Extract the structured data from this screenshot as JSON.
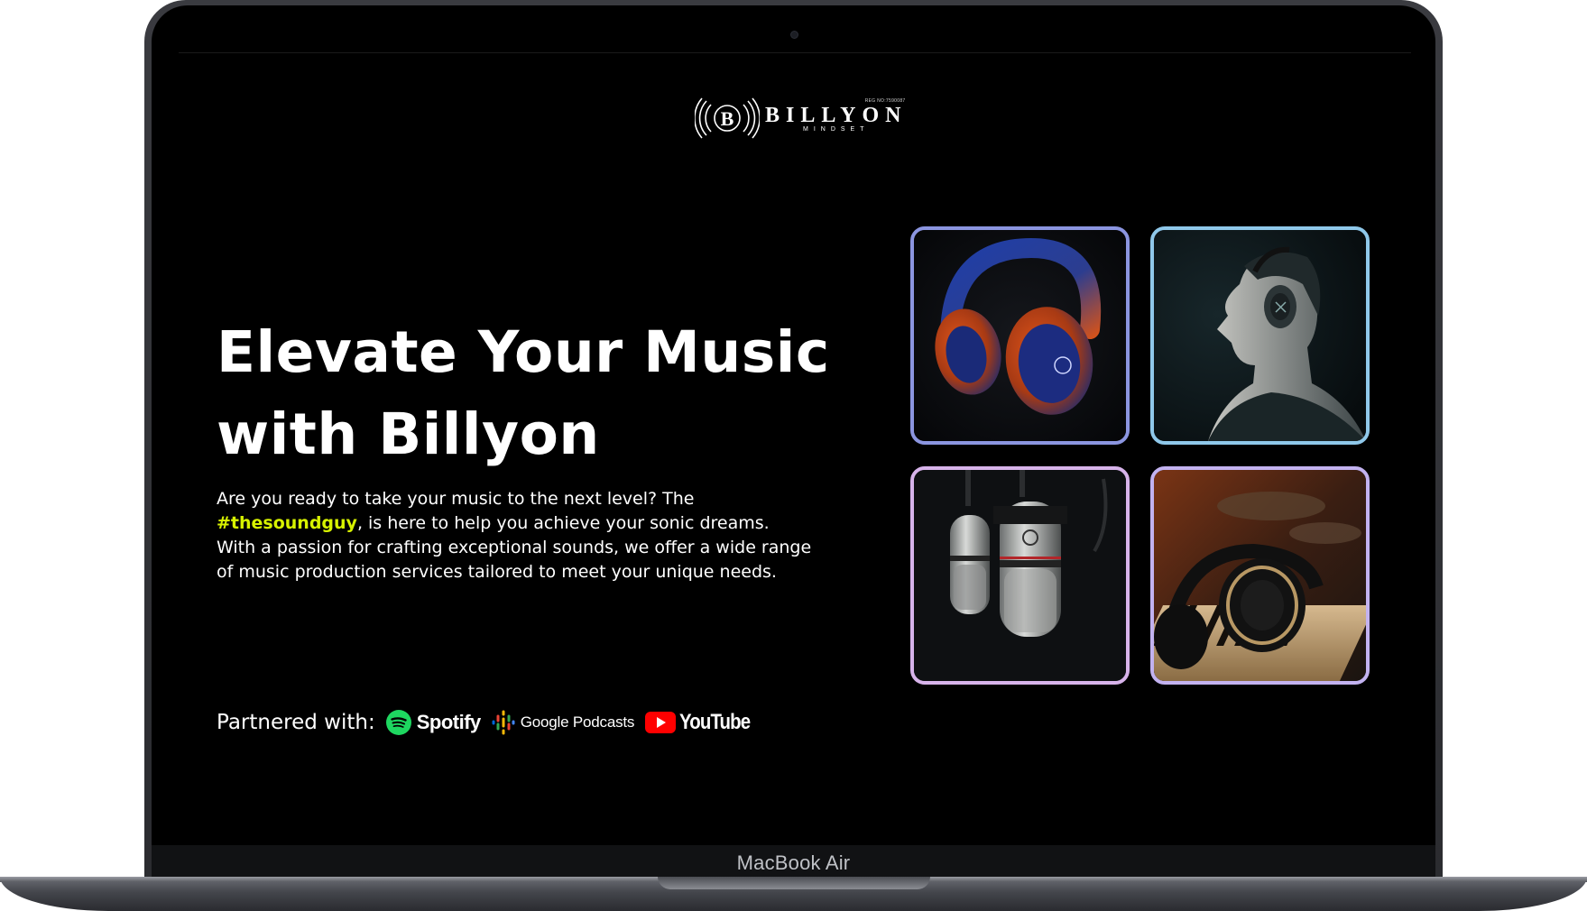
{
  "device": {
    "model_label": "MacBook Air"
  },
  "brand": {
    "logo_letter": "B",
    "name": "BILLYON",
    "tagline": "MINDSET",
    "reg_mark": "REG NO:7590087"
  },
  "hero": {
    "title_line1": "Elevate Your Music",
    "title_line2": "with Billyon",
    "body_part1": "Are you ready to take your music to the next level? The ",
    "hashtag": "#thesoundguy",
    "body_part2": ", is here to help you achieve your sonic dreams. With a passion for crafting exceptional sounds, we offer a wide range of music production services tailored to meet your unique needs."
  },
  "partners": {
    "label": "Partnered with:",
    "items": [
      {
        "name": "Spotify",
        "icon": "spotify-icon"
      },
      {
        "name": "Google Podcasts",
        "icon": "google-podcasts-icon"
      },
      {
        "name": "YouTube",
        "icon": "youtube-play-icon"
      }
    ]
  },
  "gallery": {
    "tiles": [
      {
        "subject": "headphones-orange-blue",
        "border": "#8b95e0"
      },
      {
        "subject": "man-with-headphones-profile",
        "border": "#8fc8ea"
      },
      {
        "subject": "studio-microphones",
        "border": "#d7b3ea"
      },
      {
        "subject": "headphones-on-piano",
        "border": "#c2b2f0"
      }
    ]
  },
  "colors": {
    "background": "#000000",
    "accent_hashtag": "#d7f200",
    "spotify_green": "#1ed760",
    "youtube_red": "#ff0000"
  }
}
